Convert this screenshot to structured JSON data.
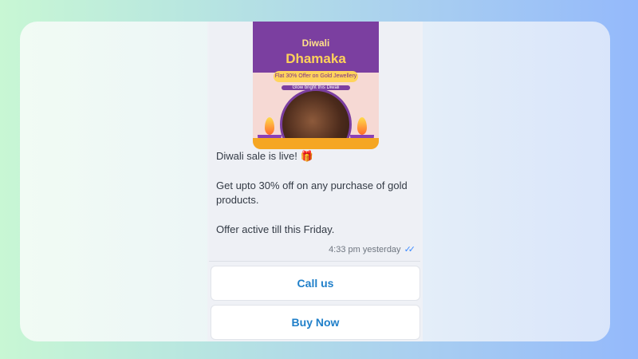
{
  "banner": {
    "title_small": "Diwali",
    "title_big": "Dhamaka",
    "offer": "Flat 30% Offer on Gold Jewellery",
    "tagline": "Glow bright this Diwali"
  },
  "message": {
    "line1": "Diwali sale is live! 🎁",
    "line2": "Get upto 30% off on any purchase of gold products.",
    "line3": "Offer active till this Friday.",
    "timestamp": "4:33 pm yesterday",
    "status_icon": "double-check-icon"
  },
  "buttons": {
    "call": "Call us",
    "buy": "Buy Now"
  }
}
